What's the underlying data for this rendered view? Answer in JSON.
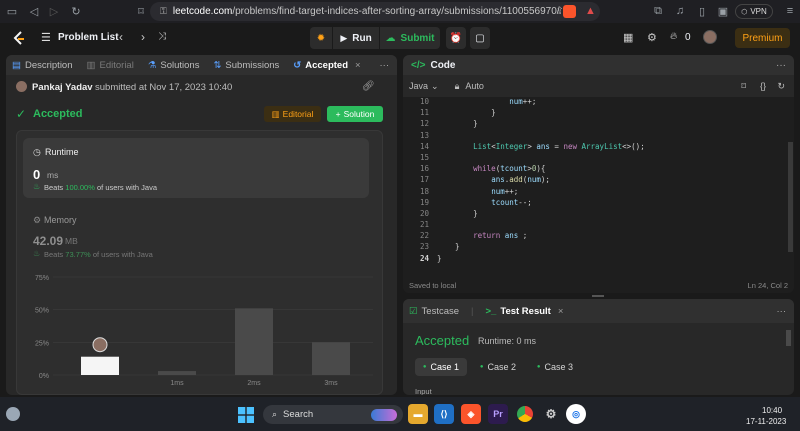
{
  "browser": {
    "url_domain": "leetcode.com",
    "url_path": "/problems/find-target-indices-after-sorting-array/submissions/1100556970/",
    "vpn_label": "VPN"
  },
  "topbar": {
    "problem_list": "Problem List",
    "run": "Run",
    "submit": "Submit",
    "streak_count": "0",
    "premium": "Premium"
  },
  "left_tabs": [
    {
      "label": "Description",
      "icon": "description-icon"
    },
    {
      "label": "Editorial",
      "icon": "editorial-icon"
    },
    {
      "label": "Solutions",
      "icon": "solutions-icon"
    },
    {
      "label": "Submissions",
      "icon": "submissions-icon"
    },
    {
      "label": "Accepted",
      "icon": "accepted-icon"
    }
  ],
  "submission": {
    "user": "Pankaj Yadav",
    "submitted_at": "submitted at Nov 17, 2023 10:40",
    "status": "Accepted",
    "editorial_btn": "Editorial",
    "solution_btn": "Solution"
  },
  "runtime": {
    "title": "Runtime",
    "value": "0",
    "unit": "ms",
    "beats_prefix": "Beats",
    "beats_pct": "100.00%",
    "beats_suffix": "of users with Java"
  },
  "memory": {
    "title": "Memory",
    "value": "42.09",
    "unit": "MB",
    "beats_prefix": "Beats",
    "beats_pct": "73.77%",
    "beats_suffix": "of users with Java"
  },
  "chart_data": {
    "type": "bar",
    "categories": [
      "0ms",
      "1ms",
      "2ms",
      "3ms"
    ],
    "x_tick_labels": [
      "",
      "1ms",
      "2ms",
      "3ms"
    ],
    "values": [
      14,
      3,
      51,
      25
    ],
    "y_ticks": [
      "75%",
      "50%",
      "25%",
      "0%"
    ],
    "ylim": [
      0,
      75
    ],
    "highlight_index": 0
  },
  "code_panel": {
    "title": "Code",
    "language": "Java",
    "mode": "Auto",
    "footer_left": "Saved to local",
    "footer_right": "Ln 24, Col 2"
  },
  "code_lines": [
    {
      "n": "10",
      "t": "                num++;"
    },
    {
      "n": "11",
      "t": "            }"
    },
    {
      "n": "12",
      "t": "        }"
    },
    {
      "n": "13",
      "t": ""
    },
    {
      "n": "14",
      "t": "        List<Integer> ans = new ArrayList<>();"
    },
    {
      "n": "15",
      "t": ""
    },
    {
      "n": "16",
      "t": "        while(tcount>0){"
    },
    {
      "n": "17",
      "t": "            ans.add(num);"
    },
    {
      "n": "18",
      "t": "            num++;"
    },
    {
      "n": "19",
      "t": "            tcount--;"
    },
    {
      "n": "20",
      "t": "        }"
    },
    {
      "n": "21",
      "t": ""
    },
    {
      "n": "22",
      "t": "        return ans ;"
    },
    {
      "n": "23",
      "t": "    }"
    },
    {
      "n": "24",
      "t": "}"
    }
  ],
  "test_panel": {
    "tab_testcase": "Testcase",
    "tab_result": "Test Result",
    "status": "Accepted",
    "runtime": "Runtime: 0 ms",
    "cases": [
      "Case 1",
      "Case 2",
      "Case 3"
    ],
    "input_label": "Input"
  },
  "taskbar": {
    "search": "Search",
    "time": "10:40",
    "date": "17-11-2023"
  }
}
